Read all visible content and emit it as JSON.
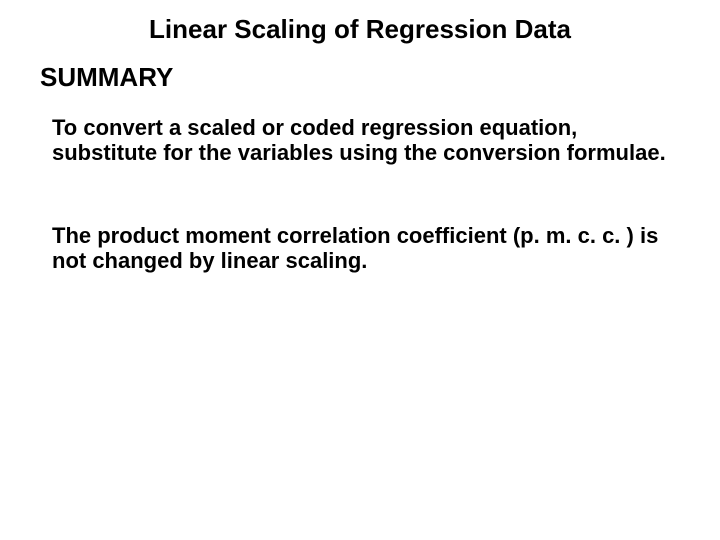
{
  "title": "Linear Scaling of Regression Data",
  "summary_label": "SUMMARY",
  "paragraph1": "To convert a scaled or coded regression equation, substitute for the variables using the conversion formulae.",
  "paragraph2": "The product moment correlation coefficient (p. m. c. c. ) is not changed by linear scaling."
}
